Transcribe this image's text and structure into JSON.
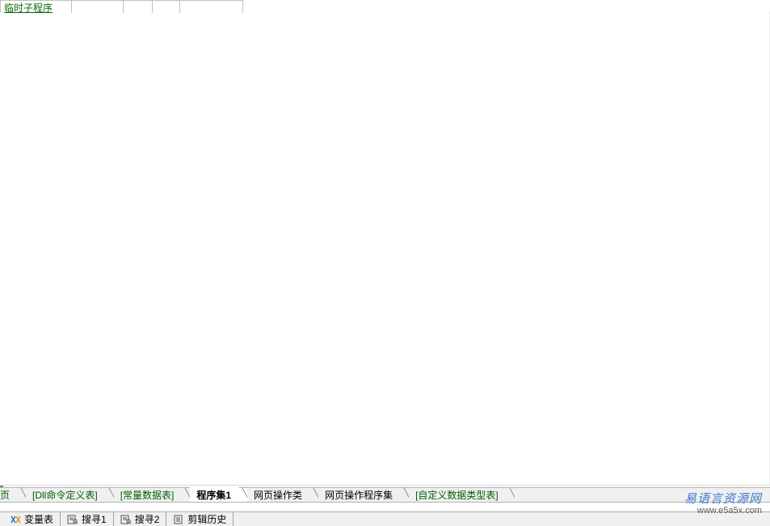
{
  "table": {
    "rows": [
      {
        "name": "临时子程序"
      }
    ]
  },
  "mainTabs": [
    {
      "label": "页",
      "active": false,
      "partial": true
    },
    {
      "label": "[Dll命令定义表]",
      "active": false
    },
    {
      "label": "[常量数据表]",
      "active": false
    },
    {
      "label": "程序集1",
      "active": true
    },
    {
      "label": "网页操作类",
      "active": false
    },
    {
      "label": "网页操作程序集",
      "active": false
    },
    {
      "label": "[自定义数据类型表]",
      "active": false
    }
  ],
  "subTabs": [
    {
      "icon": "var-icon",
      "label": "变量表"
    },
    {
      "icon": "search-icon",
      "label": "搜寻1"
    },
    {
      "icon": "search-icon",
      "label": "搜寻2"
    },
    {
      "icon": "history-icon",
      "label": "剪辑历史"
    }
  ],
  "watermark": {
    "line1": "易语言资源网",
    "line2": "www.e5a5x.com"
  }
}
